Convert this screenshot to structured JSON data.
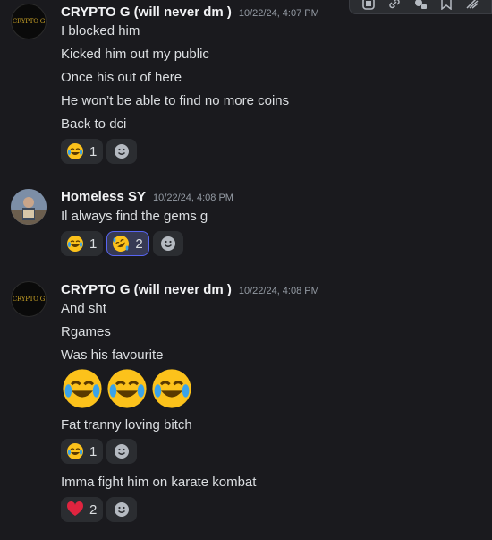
{
  "messages": [
    {
      "author": "CRYPTO G (will never dm )",
      "avatar_text": "CRYPTO G",
      "timestamp": "10/22/24, 4:07 PM",
      "lines": [
        "I blocked him",
        "Kicked him out my public",
        "Once his out of here",
        "He won’t be able to find no more coins",
        "Back to dci"
      ],
      "reactions": [
        {
          "emoji": "joy",
          "count": "1"
        }
      ]
    },
    {
      "author": "Homeless SY",
      "timestamp": "10/22/24, 4:08 PM",
      "lines": [
        "Il always find the gems g"
      ],
      "reactions": [
        {
          "emoji": "joy",
          "count": "1"
        },
        {
          "emoji": "rofl",
          "count": "2"
        }
      ]
    },
    {
      "author": "CRYPTO G (will never dm )",
      "avatar_text": "CRYPTO G",
      "timestamp": "10/22/24, 4:08 PM",
      "lines": [
        "And sht",
        "Rgames",
        "Was his favourite",
        "Fat tranny loving bitch",
        "Imma fight him on karate kombat"
      ],
      "reactions_a": [
        {
          "emoji": "joy",
          "count": "1"
        }
      ],
      "reactions_b": [
        {
          "emoji": "heart",
          "count": "2"
        }
      ]
    }
  ],
  "colors": {
    "background": "#1a1a1e",
    "username": "#f2f3f5",
    "text": "#dbdee1",
    "timestamp": "#949ba4",
    "reaction_bg": "#2b2d31"
  }
}
